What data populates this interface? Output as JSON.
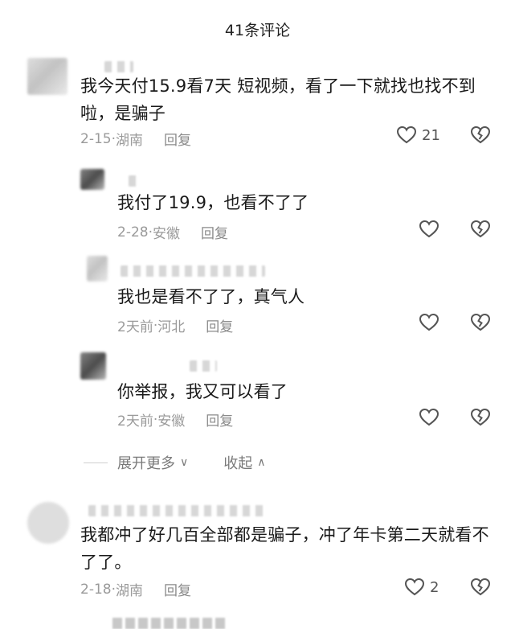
{
  "header": {
    "title": "41条评论"
  },
  "comments": [
    {
      "text": "我今天付15.9看7天 短视频，看了一下就找也找不到啦，是骗子",
      "date": "2-15",
      "location": "湖南",
      "reply_label": "回复",
      "likes": "21"
    },
    {
      "text": "我付了19.9，也看不了了",
      "date": "2-28",
      "location": "安徽",
      "reply_label": "回复",
      "likes": ""
    },
    {
      "text": "我也是看不了了，真气人",
      "date": "2天前",
      "location": "河北",
      "reply_label": "回复",
      "likes": ""
    },
    {
      "text": "你举报，我又可以看了",
      "date": "2天前",
      "location": "安徽",
      "reply_label": "回复",
      "likes": ""
    },
    {
      "text": "我都冲了好几百全部都是骗子，冲了年卡第二天就看不了了。",
      "date": "2-18",
      "location": "湖南",
      "reply_label": "回复",
      "likes": "2"
    }
  ],
  "thread": {
    "expand_label": "展开更多",
    "collapse_label": "收起"
  },
  "icons": {
    "like": "heart-outline-icon",
    "dislike": "broken-heart-icon",
    "expand": "chevron-down-icon",
    "collapse": "chevron-up-icon"
  },
  "colors": {
    "text": "#1a1a1a",
    "meta": "#9a9a9a",
    "icon": "#555555"
  }
}
